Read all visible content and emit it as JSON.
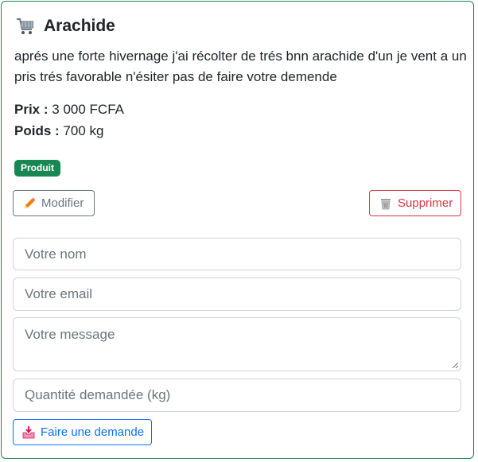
{
  "product": {
    "title": "Arachide",
    "icon": "shopping-cart-icon",
    "description": "aprés une forte hivernage j'ai récolter de trés bnn arachide d'un je vent a un pris trés favorable n'ésiter pas de faire votre demende",
    "price_label": "Prix :",
    "price_value": "3 000 FCFA",
    "weight_label": "Poids :",
    "weight_value": "700 kg",
    "badge": "Produit"
  },
  "actions": {
    "edit_label": "Modifier",
    "edit_icon": "pencil-icon",
    "delete_label": "Supprimer",
    "delete_icon": "trash-icon"
  },
  "form": {
    "name_placeholder": "Votre nom",
    "email_placeholder": "Votre email",
    "message_placeholder": "Votre message",
    "quantity_placeholder": "Quantité demandée (kg)",
    "submit_label": "Faire une demande",
    "submit_icon": "inbox-tray-icon"
  },
  "colors": {
    "card_border": "#198754",
    "badge_bg": "#198754",
    "edit": "#6c757d",
    "delete": "#dc3545",
    "submit": "#0d6efd"
  }
}
